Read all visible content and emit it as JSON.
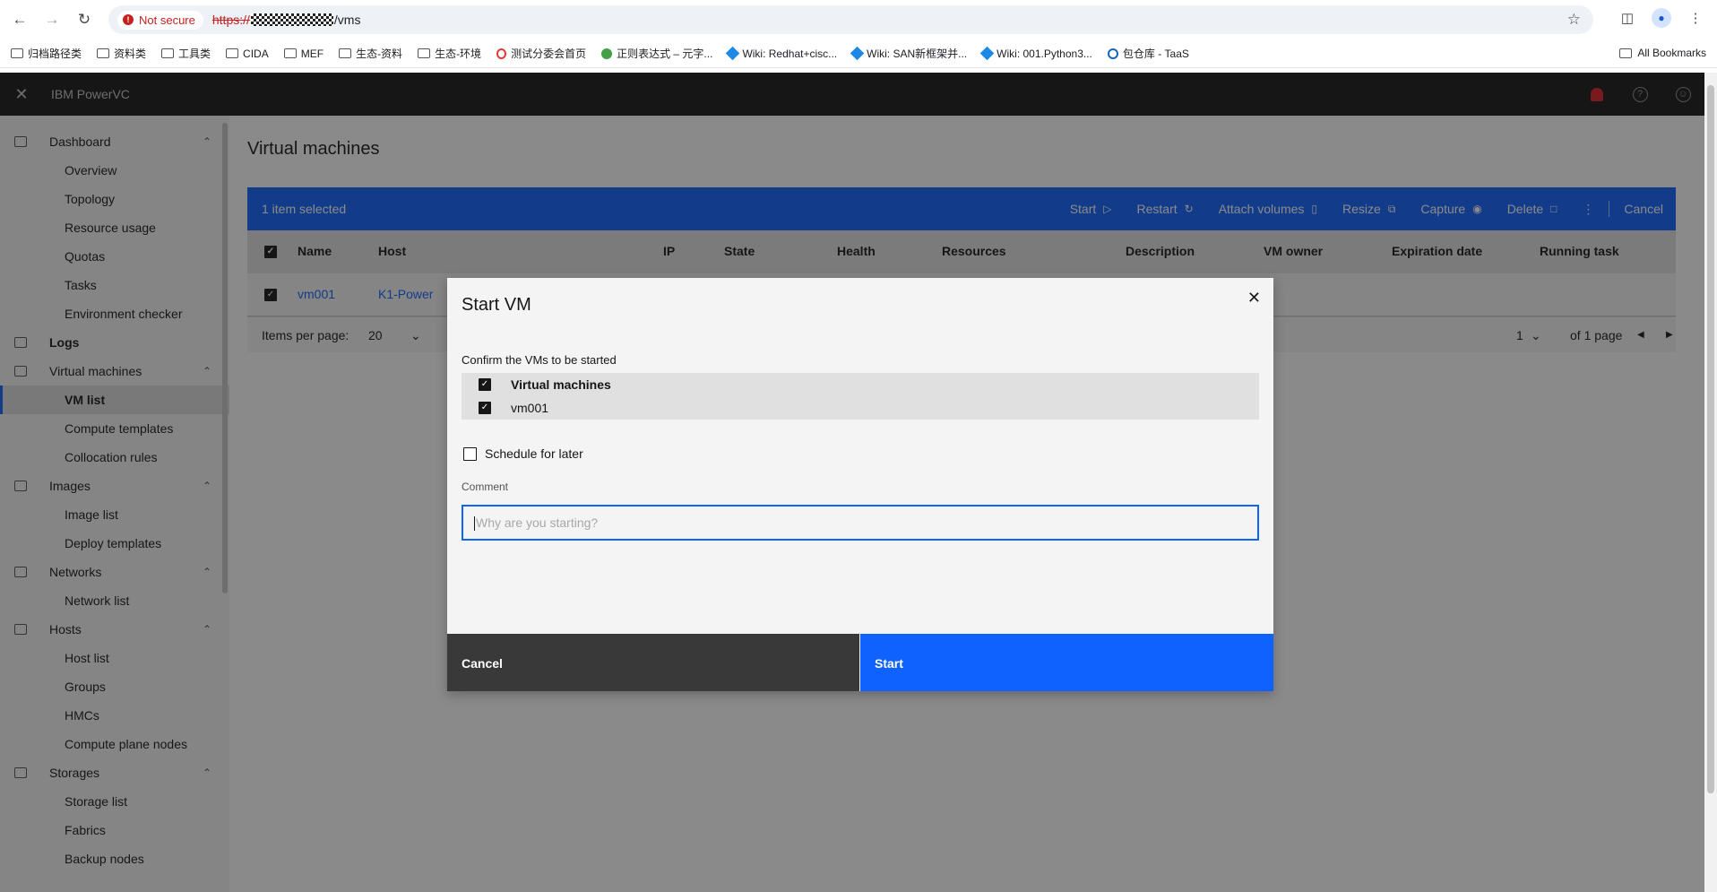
{
  "browser": {
    "security_label": "Not secure",
    "url_scheme": "https://",
    "url_path": "/vms",
    "bookmarks": [
      "归档路径类",
      "资料类",
      "工具类",
      "CIDA",
      "MEF",
      "生态-资料",
      "生态-环境",
      "测试分委会首页",
      "正则表达式 – 元字...",
      "Wiki: Redhat+cisc...",
      "Wiki: SAN新框架并...",
      "Wiki: 001.Python3...",
      "包仓库 - TaaS"
    ],
    "all_bookmarks": "All Bookmarks"
  },
  "app": {
    "title": "IBM PowerVC"
  },
  "sidebar": {
    "groups": [
      {
        "label": "Dashboard",
        "items": [
          "Overview",
          "Topology",
          "Resource usage",
          "Quotas",
          "Tasks",
          "Environment checker"
        ]
      },
      {
        "label": "Logs",
        "items": []
      },
      {
        "label": "Virtual machines",
        "items": [
          "VM list",
          "Compute templates",
          "Collocation rules"
        ]
      },
      {
        "label": "Images",
        "items": [
          "Image list",
          "Deploy templates"
        ]
      },
      {
        "label": "Networks",
        "items": [
          "Network list"
        ]
      },
      {
        "label": "Hosts",
        "items": [
          "Host list",
          "Groups",
          "HMCs",
          "Compute plane nodes"
        ]
      },
      {
        "label": "Storages",
        "items": [
          "Storage list",
          "Fabrics",
          "Backup nodes"
        ]
      }
    ],
    "active_item": "VM list"
  },
  "main": {
    "title": "Virtual machines",
    "selection": "1 item selected",
    "actions": [
      "Start",
      "Restart",
      "Attach volumes",
      "Resize",
      "Capture",
      "Delete",
      "Cancel"
    ],
    "columns": [
      "Name",
      "Host",
      "IP",
      "State",
      "Health",
      "Resources",
      "Description",
      "VM owner",
      "Expiration date",
      "Running task"
    ],
    "rows": [
      {
        "name": "vm001",
        "host": "K1-Power"
      }
    ],
    "pager": {
      "items_per_page_label": "Items per page:",
      "items_per_page": "20",
      "page": "1",
      "of_pages": "of 1 page"
    }
  },
  "modal": {
    "title": "Start VM",
    "confirm_label": "Confirm the VMs to be started",
    "vm_header": "Virtual machines",
    "vms": [
      "vm001"
    ],
    "schedule_label": "Schedule for later",
    "comment_label": "Comment",
    "comment_placeholder": "Why are you starting?",
    "cancel_label": "Cancel",
    "start_label": "Start"
  }
}
